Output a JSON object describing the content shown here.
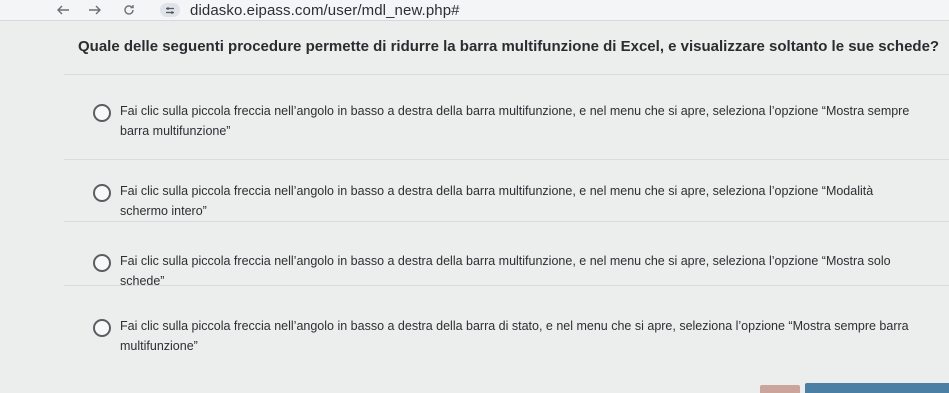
{
  "browser": {
    "url": "didasko.eipass.com/user/mdl_new.php#",
    "icons": [
      "back-arrow",
      "forward-arrow",
      "reload",
      "site-settings"
    ]
  },
  "quiz": {
    "question": "Quale delle seguenti procedure permette di ridurre la barra multifunzione di Excel, e visualizzare soltanto le sue schede?",
    "options": [
      {
        "text": "Fai clic sulla piccola freccia nell’angolo in basso a destra della barra multifunzione, e nel menu che si apre, seleziona l’opzione “Mostra sempre barra multifunzione”",
        "selected": false
      },
      {
        "text": "Fai clic sulla piccola freccia nell’angolo in basso a destra della barra multifunzione, e nel menu che si apre, seleziona l’opzione “Modalità schermo intero”",
        "selected": false
      },
      {
        "text": "Fai clic sulla piccola freccia nell’angolo in basso a destra della barra multifunzione, e nel menu che si apre, seleziona l’opzione “Mostra solo schede”",
        "selected": false
      },
      {
        "text": "Fai clic sulla piccola freccia nell’angolo in basso a destra della barra di stato, e nel menu che si apre, seleziona l’opzione “Mostra sempre barra multifunzione”",
        "selected": false
      }
    ]
  },
  "colors": {
    "page_background": "#eceeed",
    "accent_button": "#4b7fa3"
  }
}
